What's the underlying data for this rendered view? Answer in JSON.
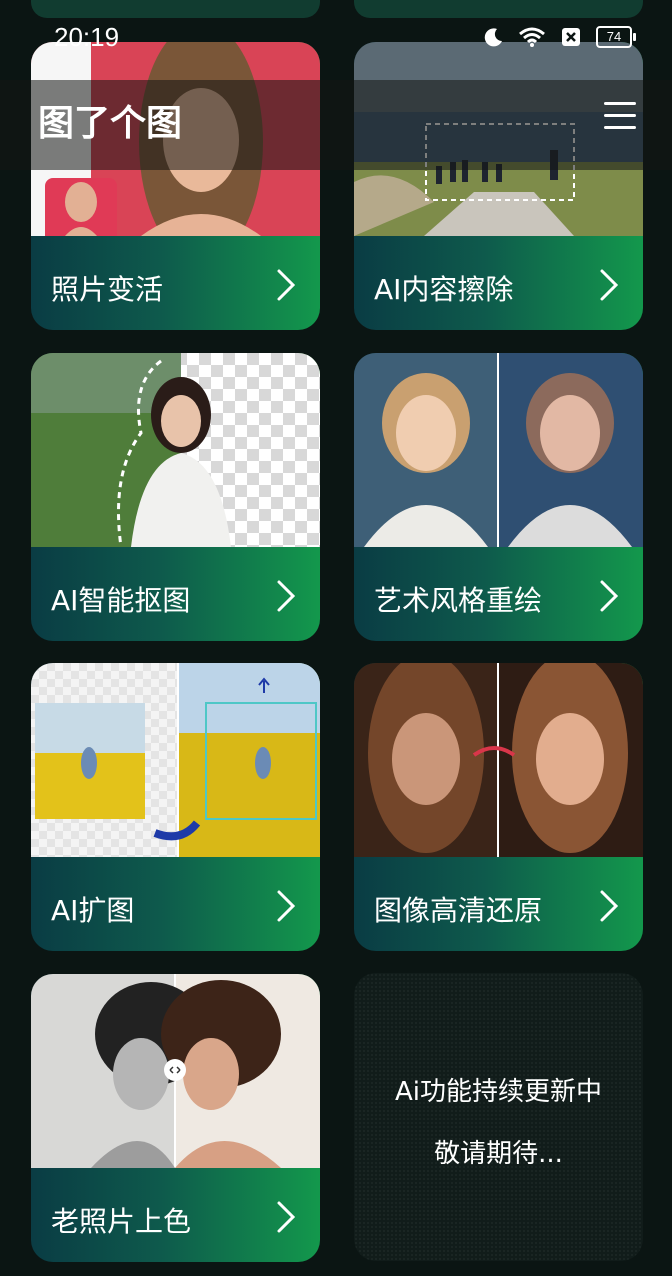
{
  "status_bar": {
    "time": "20:19",
    "battery": "74"
  },
  "app_bar": {
    "title": "图了个图"
  },
  "features": [
    {
      "label": "照片变活"
    },
    {
      "label": "AI内容擦除"
    },
    {
      "label": "AI智能抠图"
    },
    {
      "label": "艺术风格重绘"
    },
    {
      "label": "AI扩图"
    },
    {
      "label": "图像高清还原"
    },
    {
      "label": "老照片上色"
    }
  ],
  "placeholder": {
    "line1": "Ai功能持续更新中",
    "line2": "敬请期待..."
  },
  "colors": {
    "background": "#0b1513",
    "card_gradient_start": "#0a3c44",
    "card_gradient_end": "#13984c"
  }
}
